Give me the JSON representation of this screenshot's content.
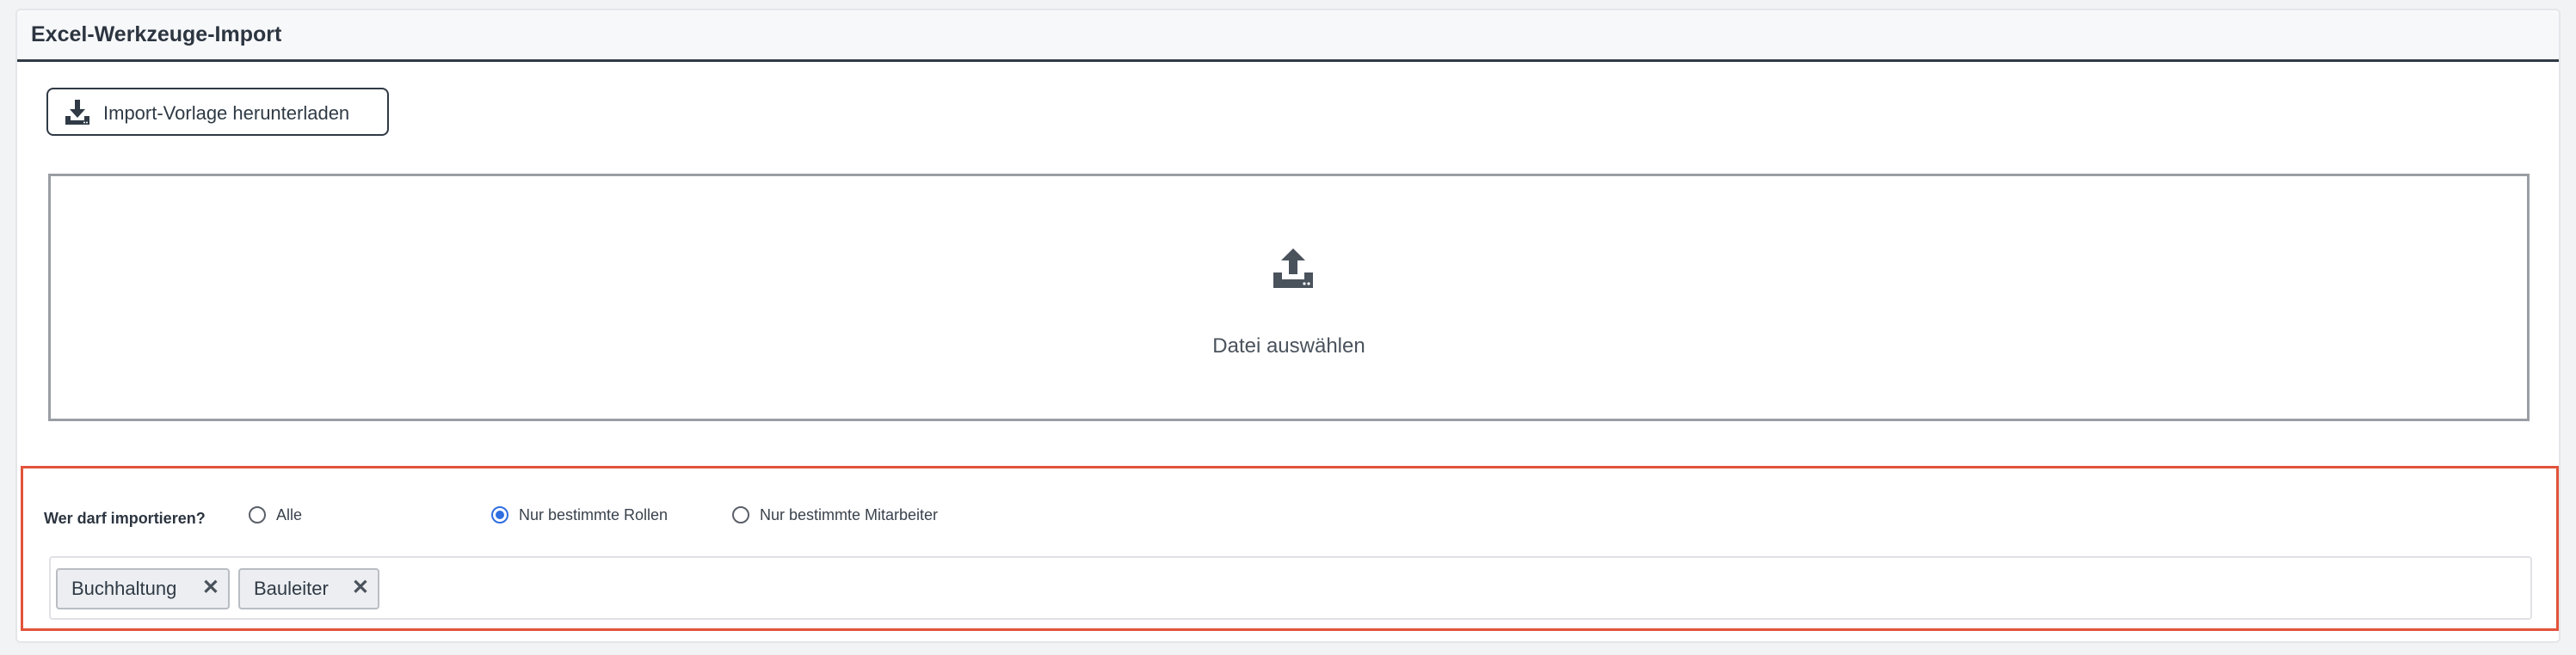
{
  "panel": {
    "title": "Excel-Werkzeuge-Import"
  },
  "template_button": {
    "label": "Import-Vorlage herunterladen",
    "icon": "download-icon"
  },
  "dropzone": {
    "label": "Datei auswählen",
    "icon": "upload-icon"
  },
  "permissions": {
    "label": "Wer darf importieren?",
    "options": [
      {
        "label": "Alle",
        "checked": false
      },
      {
        "label": "Nur bestimmte Rollen",
        "checked": true
      },
      {
        "label": "Nur bestimmte Mitarbeiter",
        "checked": false
      }
    ],
    "tags": [
      {
        "label": "Buchhaltung",
        "remove": "✕"
      },
      {
        "label": "Bauleiter",
        "remove": "✕"
      }
    ]
  },
  "colors": {
    "accent": "#2f6fe0",
    "highlight_border": "#e2533a",
    "dark": "#2f3a45"
  }
}
